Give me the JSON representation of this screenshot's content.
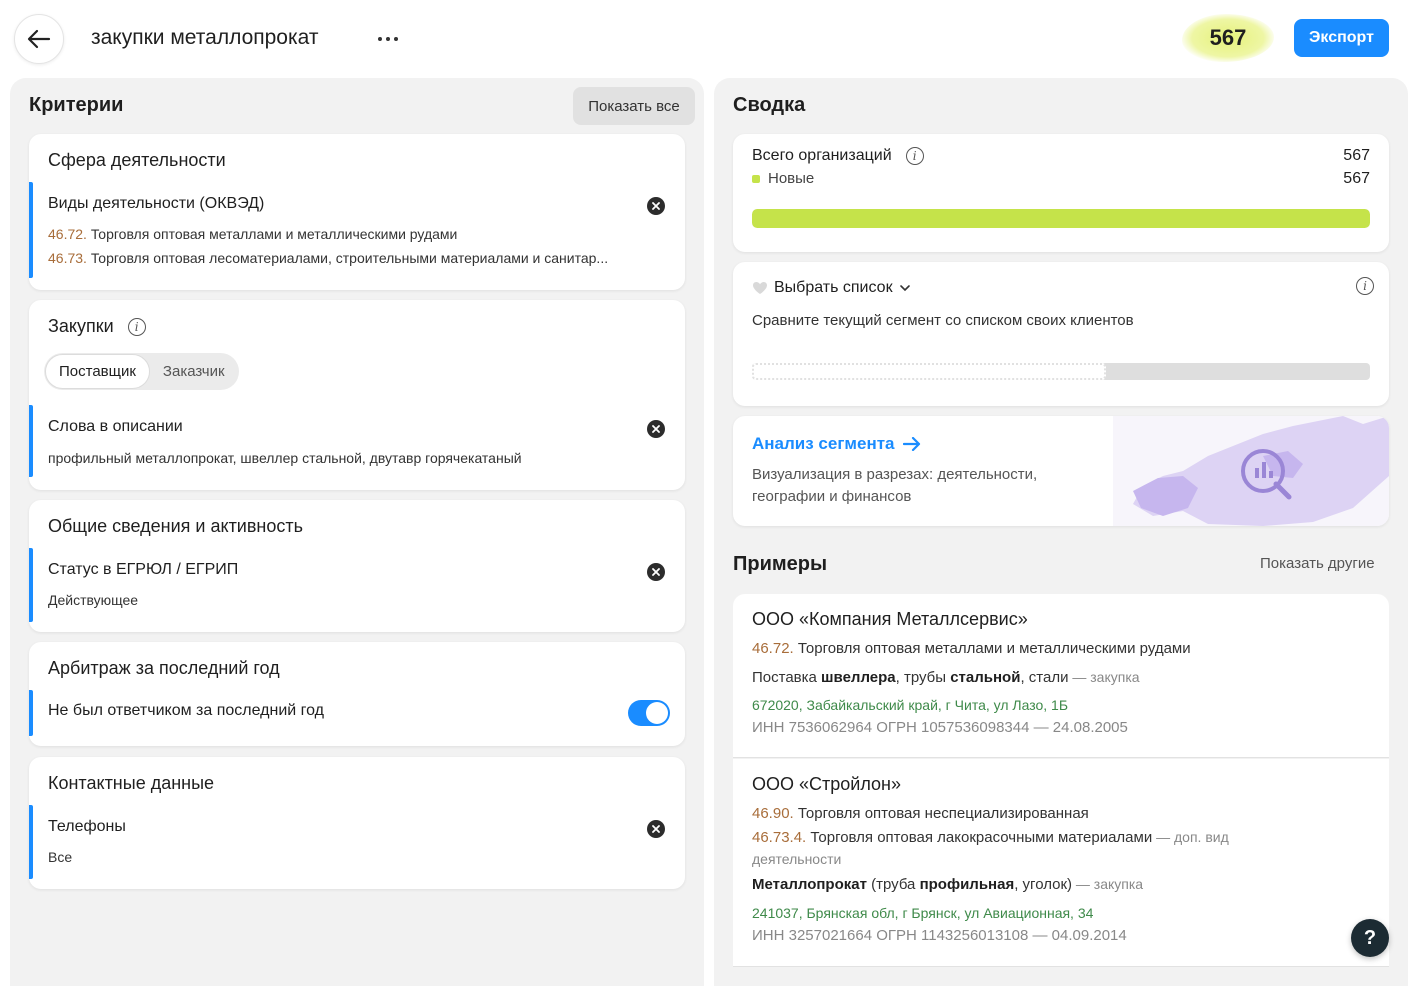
{
  "header": {
    "title": "закупки металлопрокат",
    "count": "567",
    "export_label": "Экспорт"
  },
  "criteria": {
    "title": "Критерии",
    "show_all_label": "Показать все",
    "activity": {
      "heading": "Сфера деятельности",
      "name": "Виды деятельности (ОКВЭД)",
      "items": [
        {
          "code": "46.72.",
          "text": "Торговля оптовая металлами и металлическими рудами"
        },
        {
          "code": "46.73.",
          "text": "Торговля оптовая лесоматериалами, строительными материалами и санитар..."
        }
      ]
    },
    "purchases": {
      "heading": "Закупки",
      "roles": [
        "Поставщик",
        "Заказчик"
      ],
      "active_role": "Поставщик",
      "name": "Слова в описании",
      "value": "профильный металлопрокат, швеллер стальной, двутавр горячекатаный"
    },
    "general": {
      "heading": "Общие сведения и активность",
      "name": "Статус в ЕГРЮЛ / ЕГРИП",
      "value": "Действующее"
    },
    "arbitration": {
      "heading": "Арбитраж за последний год",
      "name": "Не был ответчиком за последний год",
      "toggle_on": true
    },
    "contacts": {
      "heading": "Контактные данные",
      "name": "Телефоны",
      "value": "Все"
    }
  },
  "summary": {
    "title": "Сводка",
    "total_label": "Всего организаций",
    "total_value": "567",
    "new_label": "Новые",
    "new_value": "567",
    "new_fraction": 1.0,
    "pick_list_label": "Выбрать список",
    "compare_text": "Сравните текущий сегмент со списком своих клиентов",
    "analysis_link": "Анализ сегмента",
    "analysis_desc": "Визуализация в разрезах: деятельности, географии и финансов"
  },
  "examples": {
    "title": "Примеры",
    "show_other_label": "Показать другие",
    "companies": [
      {
        "name": "ООО «Компания Металлсервис»",
        "activities": [
          {
            "code": "46.72.",
            "text": "Торговля оптовая металлами и металлическими рудами",
            "note": ""
          }
        ],
        "purchase_pre": "Поставка ",
        "purchase_b1": "швеллера",
        "purchase_mid": ", трубы ",
        "purchase_b2": "стальной",
        "purchase_post": ", стали",
        "purchase_tag": " — закупка",
        "address": "672020, Забайкальский край, г Чита, ул Лазо, 1Б",
        "ids": "ИНН 7536062964  ОГРН 1057536098344 — 24.08.2005"
      },
      {
        "name": "ООО «Стройлон»",
        "activities": [
          {
            "code": "46.90.",
            "text": "Торговля оптовая неспециализированная",
            "note": ""
          },
          {
            "code": "46.73.4.",
            "text": "Торговля оптовая лакокрасочными материалами",
            "note": " — доп. вид",
            "note2": "деятельности"
          }
        ],
        "purchase_b1": "Металлопрокат",
        "purchase_mid": " (труба ",
        "purchase_b2": "профильная",
        "purchase_post": ", уголок)",
        "purchase_tag": " — закупка",
        "address": "241037, Брянская обл, г Брянск, ул Авиационная, 34",
        "ids": "ИНН 3257021664  ОГРН 1143256013108 — 04.09.2014"
      }
    ]
  },
  "help_label": "?",
  "colors": {
    "accent": "#1a8cff",
    "lime": "#c5e34a",
    "code": "#a86d3a",
    "address": "#3f8a4a"
  },
  "icons": [
    "arrow-left-icon",
    "more-dots-icon",
    "close-icon",
    "info-icon",
    "heart-icon",
    "chevron-down-icon",
    "arrow-right-icon",
    "map-icon",
    "chart-search-icon",
    "help-icon"
  ]
}
